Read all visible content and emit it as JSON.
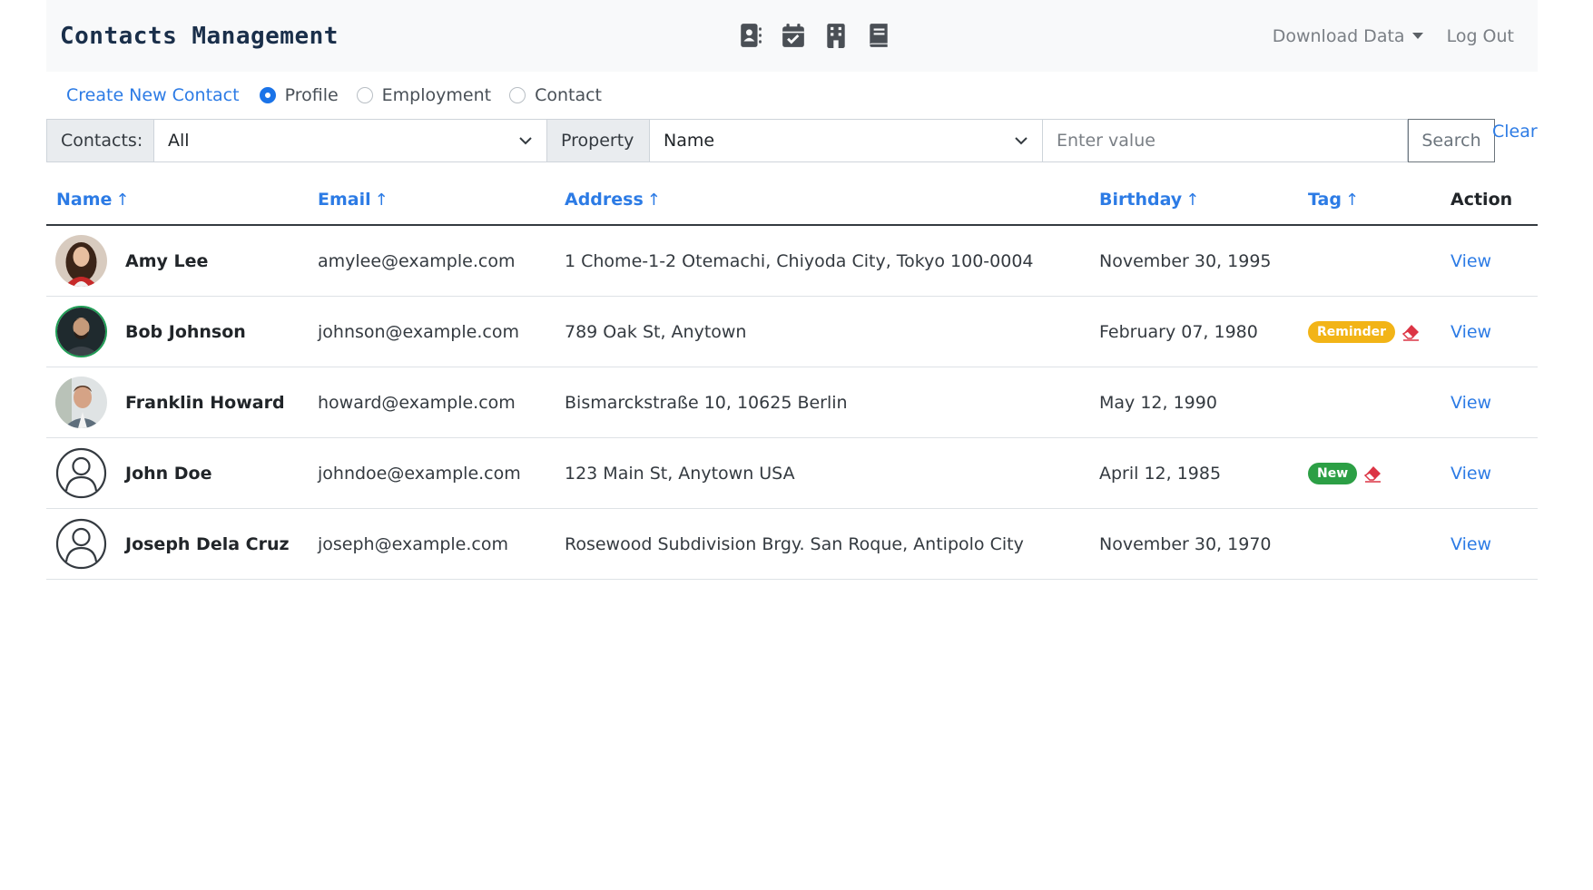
{
  "navbar": {
    "brand": "Contacts Management",
    "icons": [
      "contact-book-icon",
      "calendar-check-icon",
      "building-icon",
      "book-icon"
    ],
    "download_label": "Download Data",
    "logout_label": "Log Out"
  },
  "filters": {
    "create_label": "Create New Contact",
    "radios": [
      {
        "label": "Profile",
        "checked": true
      },
      {
        "label": "Employment",
        "checked": false
      },
      {
        "label": "Contact",
        "checked": false
      }
    ]
  },
  "search": {
    "contacts_label": "Contacts:",
    "contacts_value": "All",
    "property_label": "Property",
    "property_value": "Name",
    "placeholder": "Enter value",
    "search_label": "Search",
    "clear_label": "Clear"
  },
  "table": {
    "headers": {
      "name": "Name",
      "email": "Email",
      "address": "Address",
      "birthday": "Birthday",
      "tag": "Tag",
      "action": "Action",
      "sort_arrow": "↑"
    },
    "rows": [
      {
        "name": "Amy Lee",
        "email": "amylee@example.com",
        "address": "1 Chome-1-2 Otemachi, Chiyoda City, Tokyo 100-0004",
        "birthday": "November 30, 1995",
        "tag": "",
        "action": "View"
      },
      {
        "name": "Bob Johnson",
        "email": "johnson@example.com",
        "address": "789 Oak St, Anytown",
        "birthday": "February 07, 1980",
        "tag": "Reminder",
        "action": "View"
      },
      {
        "name": "Franklin Howard",
        "email": "howard@example.com",
        "address": "Bismarckstraße 10, 10625 Berlin",
        "birthday": "May 12, 1990",
        "tag": "",
        "action": "View"
      },
      {
        "name": "John Doe",
        "email": "johndoe@example.com",
        "address": "123 Main St, Anytown USA",
        "birthday": "April 12, 1985",
        "tag": "New",
        "action": "View"
      },
      {
        "name": "Joseph Dela Cruz",
        "email": "joseph@example.com",
        "address": "Rosewood Subdivision Brgy. San Roque, Antipolo City",
        "birthday": "November 30, 1970",
        "tag": "",
        "action": "View"
      }
    ]
  },
  "colors": {
    "link": "#2c7be5",
    "brand": "#1a2f4a",
    "reminder_badge": "#f2b417",
    "new_badge": "#2c9f45",
    "eraser": "#dc3545"
  }
}
